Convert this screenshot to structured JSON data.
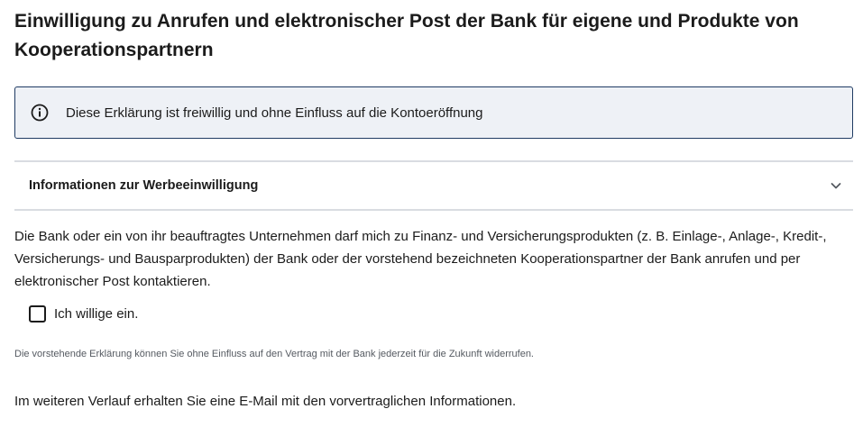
{
  "section": {
    "title": "Einwilligung zu Anrufen und elektronischer Post der Bank für eigene und Produkte von Kooperationspartnern"
  },
  "info_box": {
    "icon": "info-icon",
    "text": "Diese Erklärung ist freiwillig und ohne Einfluss auf die Kontoeröffnung"
  },
  "accordion": {
    "label": "Informationen zur Werbeeinwilligung",
    "expanded": false,
    "icon": "chevron-down-icon"
  },
  "body": {
    "text": "Die Bank oder ein von ihr beauftragtes Unternehmen darf mich zu Finanz- und Versicherungsprodukten (z. B. Einlage-, Anlage-, Kredit-, Versicherungs- und Bausparprodukten) der Bank oder der vorstehend bezeichneten Kooperationspartner der Bank anrufen und per elektronischer Post kontaktieren."
  },
  "consent": {
    "label": "Ich willige ein.",
    "checked": false
  },
  "note": {
    "text": "Die vorstehende Erklärung können Sie ohne Einfluss auf den Vertrag mit der Bank jederzeit für die Zukunft widerrufen."
  },
  "footer": {
    "text": "Im weiteren Verlauf erhalten Sie eine E-Mail mit den vorvertraglichen Informationen."
  },
  "colors": {
    "info_background": "#eef1f6",
    "info_border": "#1f3b63",
    "divider": "#d9dce1",
    "text": "#1b1b1b"
  }
}
